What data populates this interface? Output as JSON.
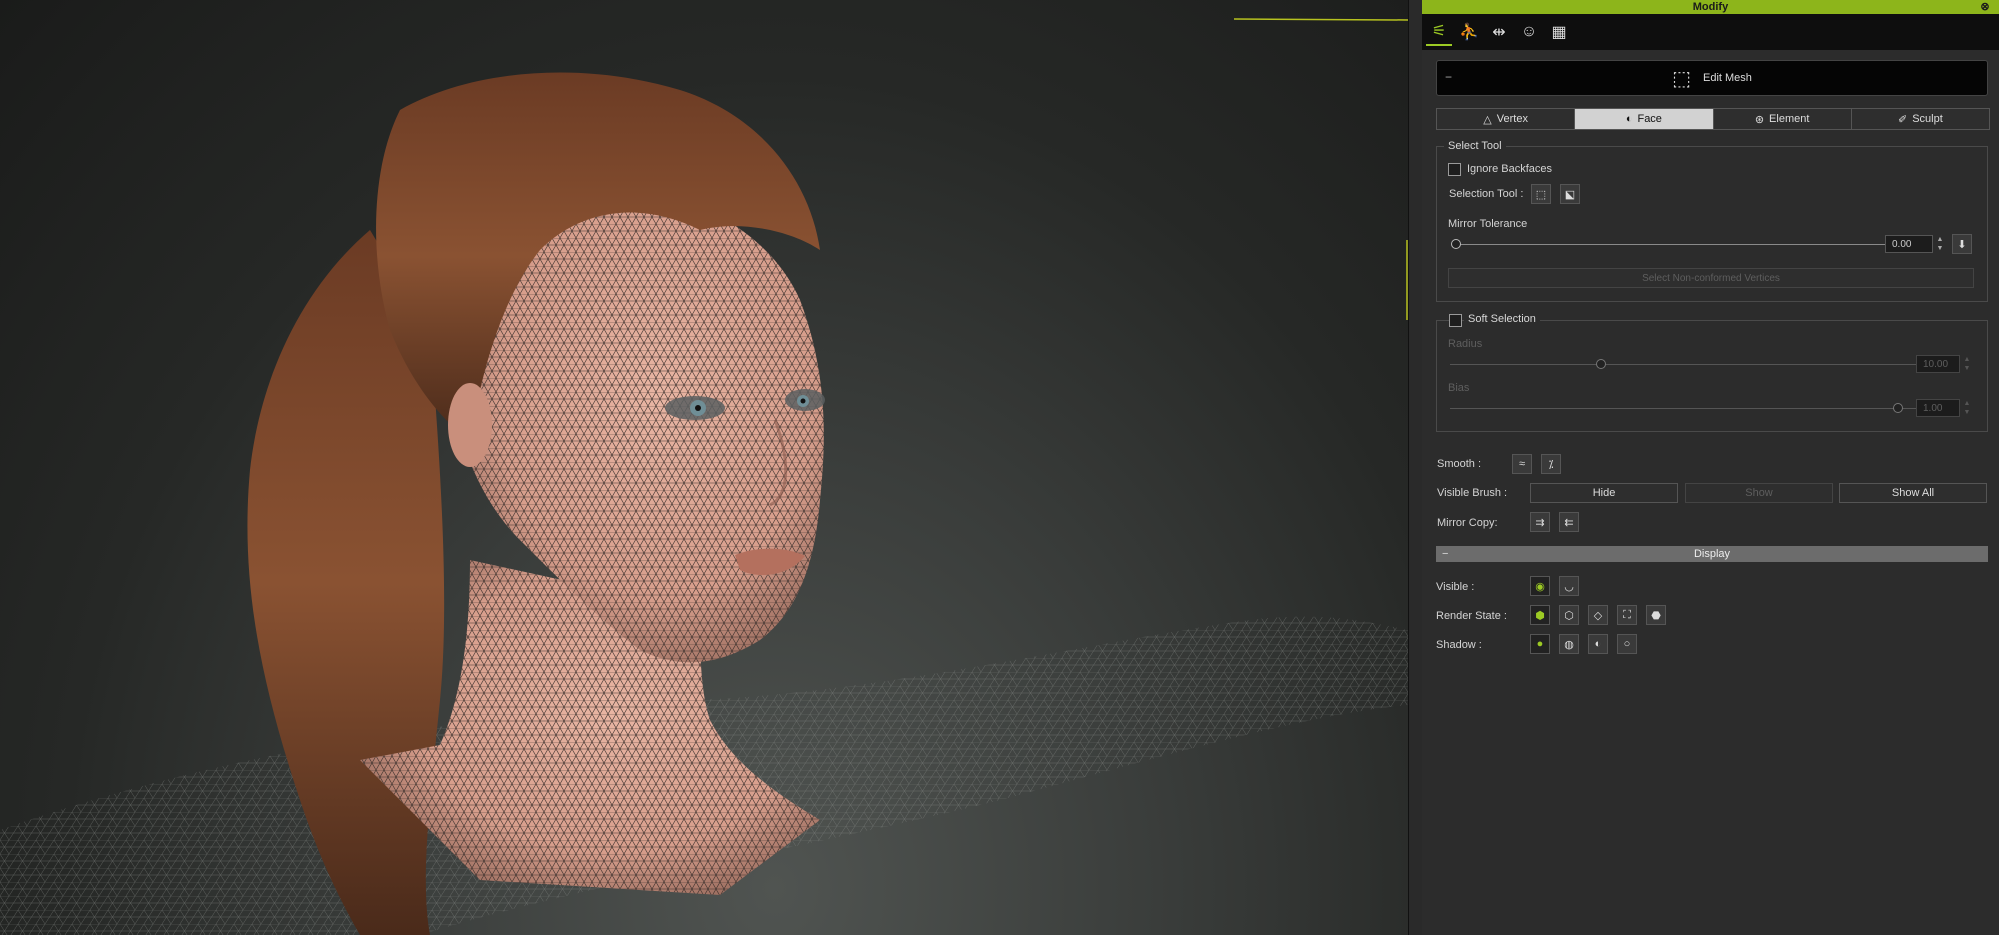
{
  "panel": {
    "title": "Modify",
    "close_glyph": "⊗",
    "toolbar": [
      {
        "icon": "sliders-icon",
        "glyph": "⚟"
      },
      {
        "icon": "pose-icon",
        "glyph": "⛹"
      },
      {
        "icon": "morph-icon",
        "glyph": "⇹"
      },
      {
        "icon": "face-morph-icon",
        "glyph": "☺"
      },
      {
        "icon": "texture-checker-icon",
        "glyph": "▦"
      }
    ],
    "edit_mesh_label": "Edit Mesh",
    "modes": [
      {
        "label": "Vertex",
        "glyph": "△"
      },
      {
        "label": "Face",
        "glyph": "◐"
      },
      {
        "label": "Element",
        "glyph": "⊛"
      },
      {
        "label": "Sculpt",
        "glyph": "✐"
      }
    ],
    "select_tool": {
      "legend": "Select Tool",
      "ignore_backfaces": "Ignore Backfaces",
      "selection_tool_label": "Selection Tool :",
      "mirror_tolerance_label": "Mirror Tolerance",
      "mirror_tolerance_value": "0.00",
      "select_non_conformed": "Select Non-conformed Vertices"
    },
    "soft_selection": {
      "legend": "Soft Selection",
      "radius_label": "Radius",
      "radius_value": "10.00",
      "bias_label": "Bias",
      "bias_value": "1.00"
    },
    "smooth_label": "Smooth :",
    "visible_brush_label": "Visible Brush :",
    "hide_label": "Hide",
    "show_label": "Show",
    "show_all_label": "Show All",
    "mirror_copy_label": "Mirror Copy:",
    "display": {
      "title": "Display",
      "visible_label": "Visible :",
      "render_state_label": "Render State :",
      "shadow_label": "Shadow :"
    }
  },
  "colors": {
    "accent": "#8db51b",
    "panel_bg": "#2c2c2c",
    "toolbar_bg": "#0e0e0e"
  }
}
